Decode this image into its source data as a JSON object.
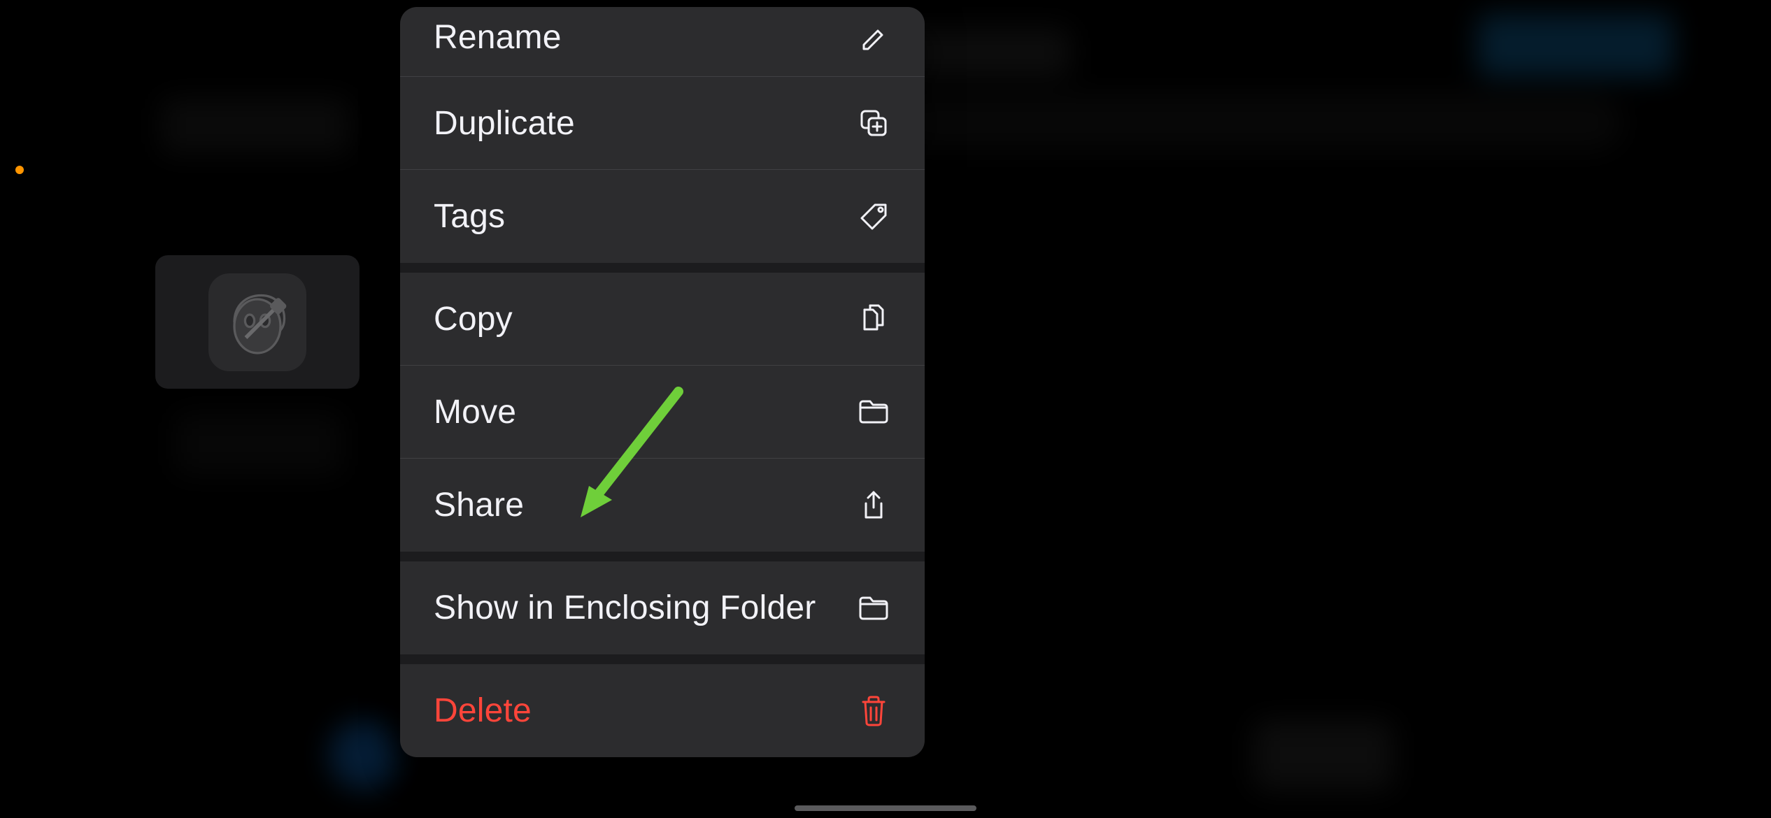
{
  "background": {
    "orange_indicator": true
  },
  "file_preview": {
    "icon_name": "garageband-icon"
  },
  "menu": {
    "groups": [
      {
        "items": [
          {
            "label": "Rename",
            "icon": "pencil-icon",
            "destructive": false,
            "partial": true
          },
          {
            "label": "Duplicate",
            "icon": "duplicate-icon",
            "destructive": false
          },
          {
            "label": "Tags",
            "icon": "tag-icon",
            "destructive": false
          }
        ]
      },
      {
        "items": [
          {
            "label": "Copy",
            "icon": "copy-documents-icon",
            "destructive": false
          },
          {
            "label": "Move",
            "icon": "folder-icon",
            "destructive": false
          },
          {
            "label": "Share",
            "icon": "share-icon",
            "destructive": false
          }
        ]
      },
      {
        "items": [
          {
            "label": "Show in Enclosing Folder",
            "icon": "folder-icon",
            "destructive": false
          }
        ]
      },
      {
        "items": [
          {
            "label": "Delete",
            "icon": "trash-icon",
            "destructive": true
          }
        ]
      }
    ]
  },
  "annotation": {
    "arrow_color": "#6fcf3a",
    "points_to": "Share"
  }
}
